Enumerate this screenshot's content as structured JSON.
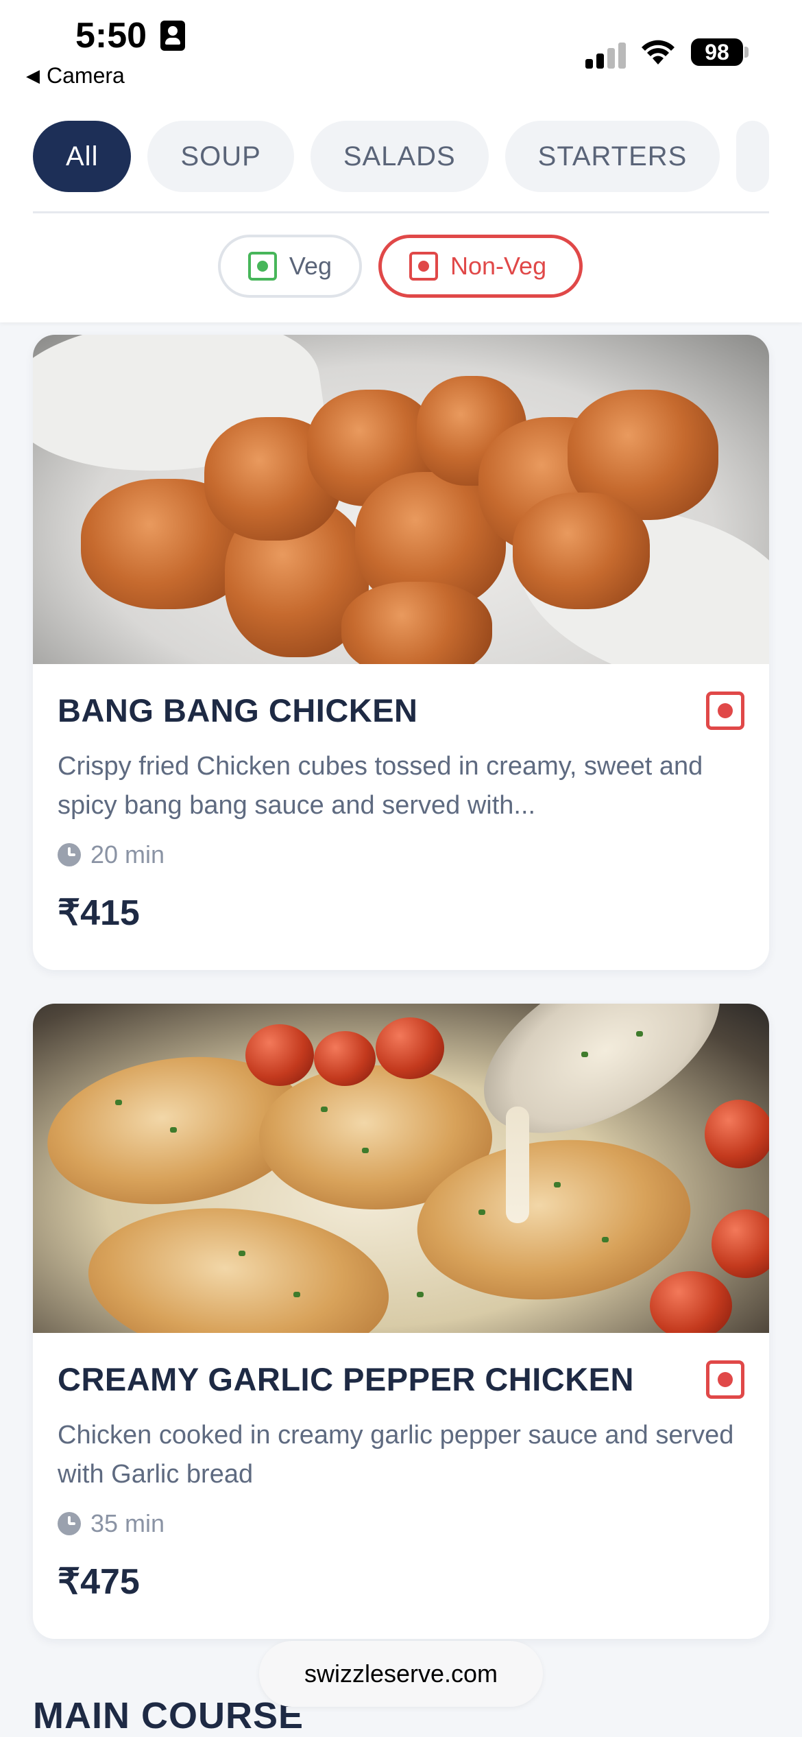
{
  "status_bar": {
    "time": "5:50",
    "back_label": "Camera",
    "battery": "98"
  },
  "categories": [
    "All",
    "SOUP",
    "SALADS",
    "STARTERS",
    ""
  ],
  "filters": {
    "veg_label": "Veg",
    "nonveg_label": "Non-Veg"
  },
  "items": [
    {
      "title": "BANG BANG CHICKEN",
      "description": "Crispy fried Chicken cubes tossed in creamy, sweet and spicy bang bang sauce and served with...",
      "time": "20 min",
      "price": "₹415",
      "diet": "non-veg"
    },
    {
      "title": "CREAMY GARLIC PEPPER CHICKEN",
      "description": "Chicken cooked in creamy garlic pepper sauce and served with Garlic bread",
      "time": "35 min",
      "price": "₹475",
      "diet": "non-veg"
    }
  ],
  "next_section": "MAIN COURSE",
  "browser_domain": "swizzleserve.com",
  "colors": {
    "primary": "#1d2f57",
    "nonveg_red": "#e04848",
    "veg_green": "#47b65a",
    "chip_bg": "#f1f3f6"
  }
}
